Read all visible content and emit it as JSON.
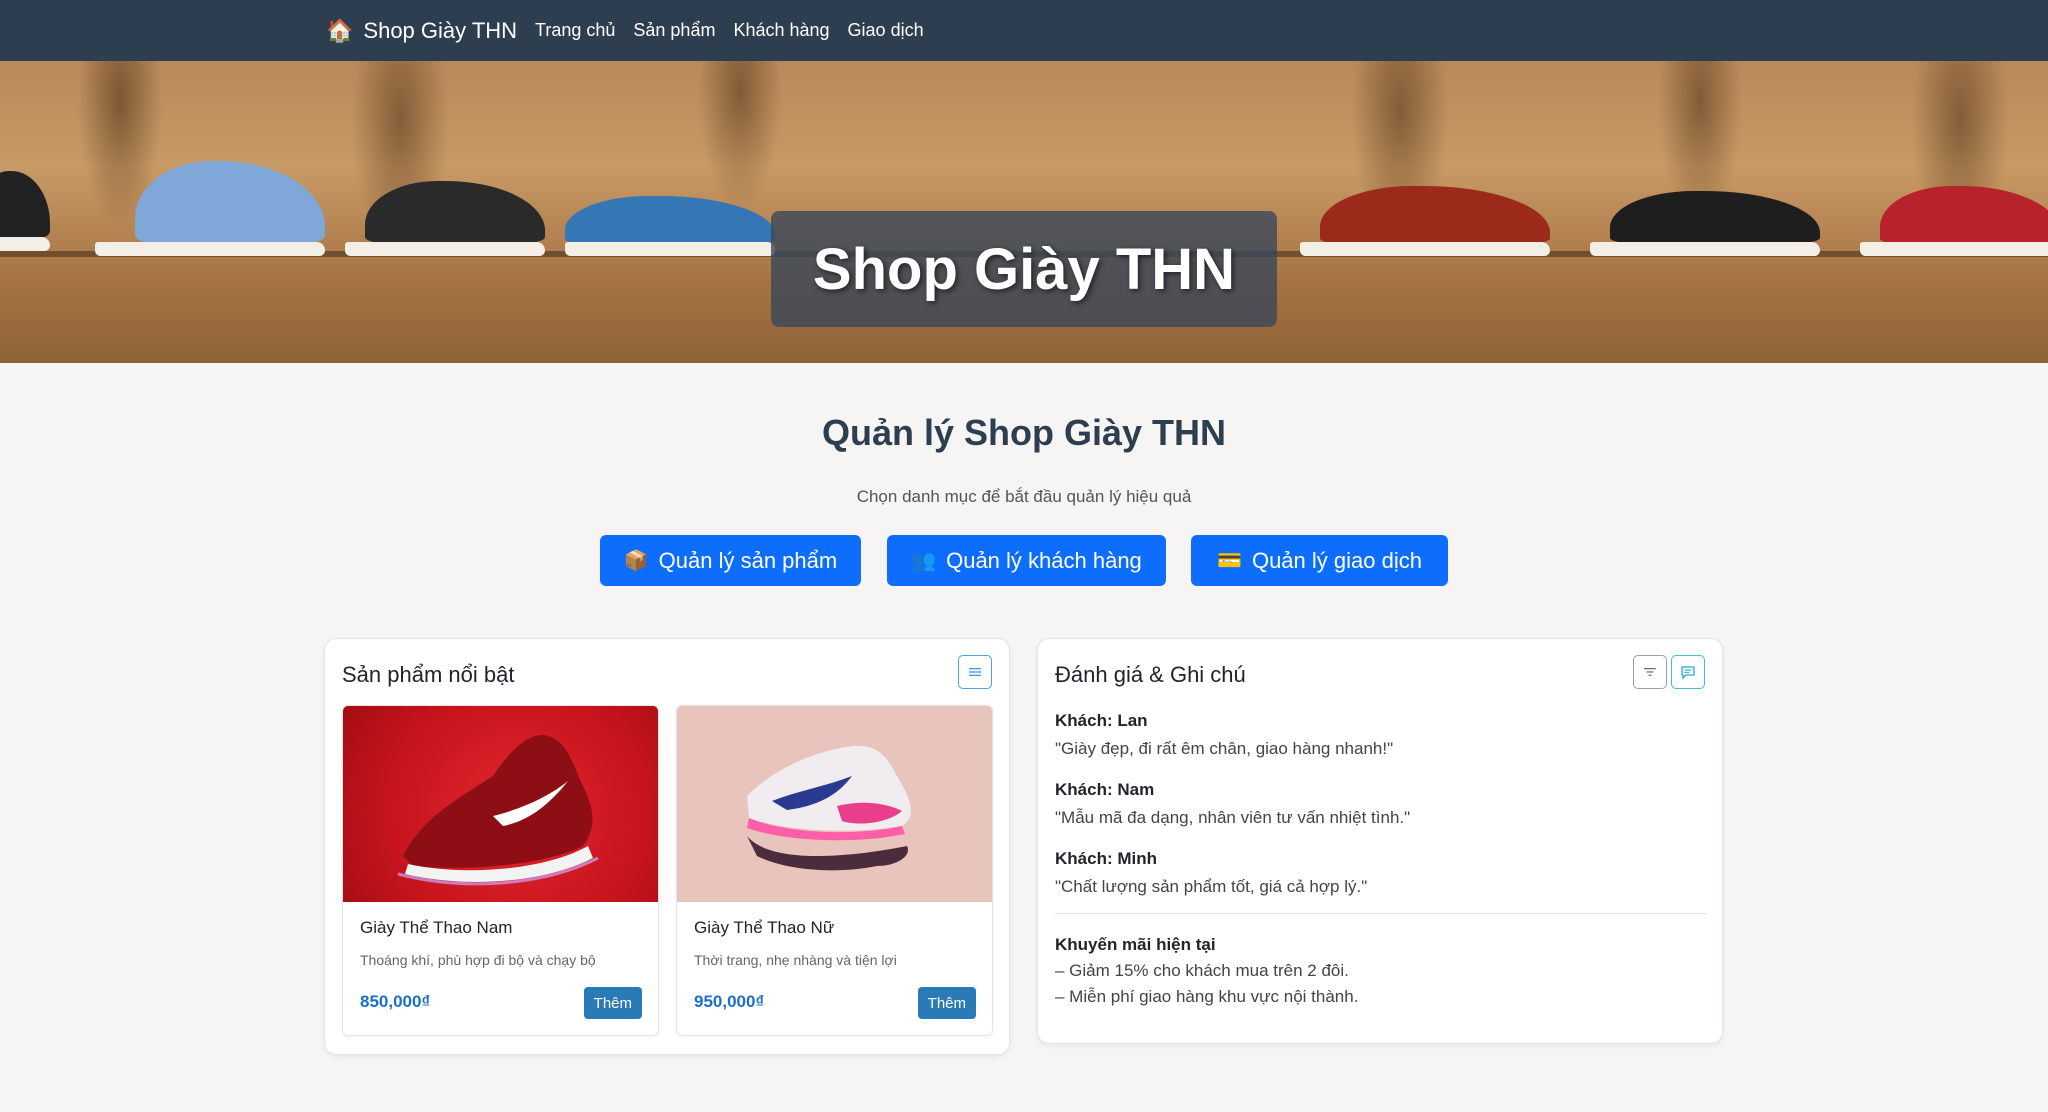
{
  "navbar": {
    "brand_icon": "🏠",
    "brand": "Shop Giày THN",
    "links": [
      "Trang chủ",
      "Sản phẩm",
      "Khách hàng",
      "Giao dịch"
    ]
  },
  "hero": {
    "title": "Shop Giày THN"
  },
  "main": {
    "title": "Quản lý Shop Giày THN",
    "subtitle": "Chọn danh mục để bắt đầu quản lý hiệu quả",
    "buttons": [
      {
        "icon": "📦",
        "label": "Quản lý sản phẩm"
      },
      {
        "icon": "👥",
        "label": "Quản lý khách hàng"
      },
      {
        "icon": "💳",
        "label": "Quản lý giao dịch"
      }
    ]
  },
  "featured": {
    "title": "Sản phẩm nổi bật",
    "products": [
      {
        "name": "Giày Thể Thao Nam",
        "desc": "Thoáng khí, phù hợp đi bộ và chạy bộ",
        "price": "850,000₫",
        "add_label": "Thêm"
      },
      {
        "name": "Giày Thể Thao Nữ",
        "desc": "Thời trang, nhẹ nhàng và tiện lợi",
        "price": "950,000₫",
        "add_label": "Thêm"
      }
    ]
  },
  "reviews": {
    "title": "Đánh giá & Ghi chú",
    "items": [
      {
        "who": "Khách: Lan",
        "quote": "\"Giày đẹp, đi rất êm chân, giao hàng nhanh!\""
      },
      {
        "who": "Khách: Nam",
        "quote": "\"Mẫu mã đa dạng, nhân viên tư vấn nhiệt tình.\""
      },
      {
        "who": "Khách: Minh",
        "quote": "\"Chất lượng sản phẩm tốt, giá cả hợp lý.\""
      }
    ],
    "promo_title": "Khuyến mãi hiện tại",
    "promo_lines": [
      "– Giảm 15% cho khách mua trên 2 đôi.",
      "– Miễn phí giao hàng khu vực nội thành."
    ]
  },
  "colors": {
    "navbar": "#2c3e50",
    "primary": "#0d6efd",
    "price": "#1c6fc9",
    "add_button": "#2a7ab8"
  }
}
